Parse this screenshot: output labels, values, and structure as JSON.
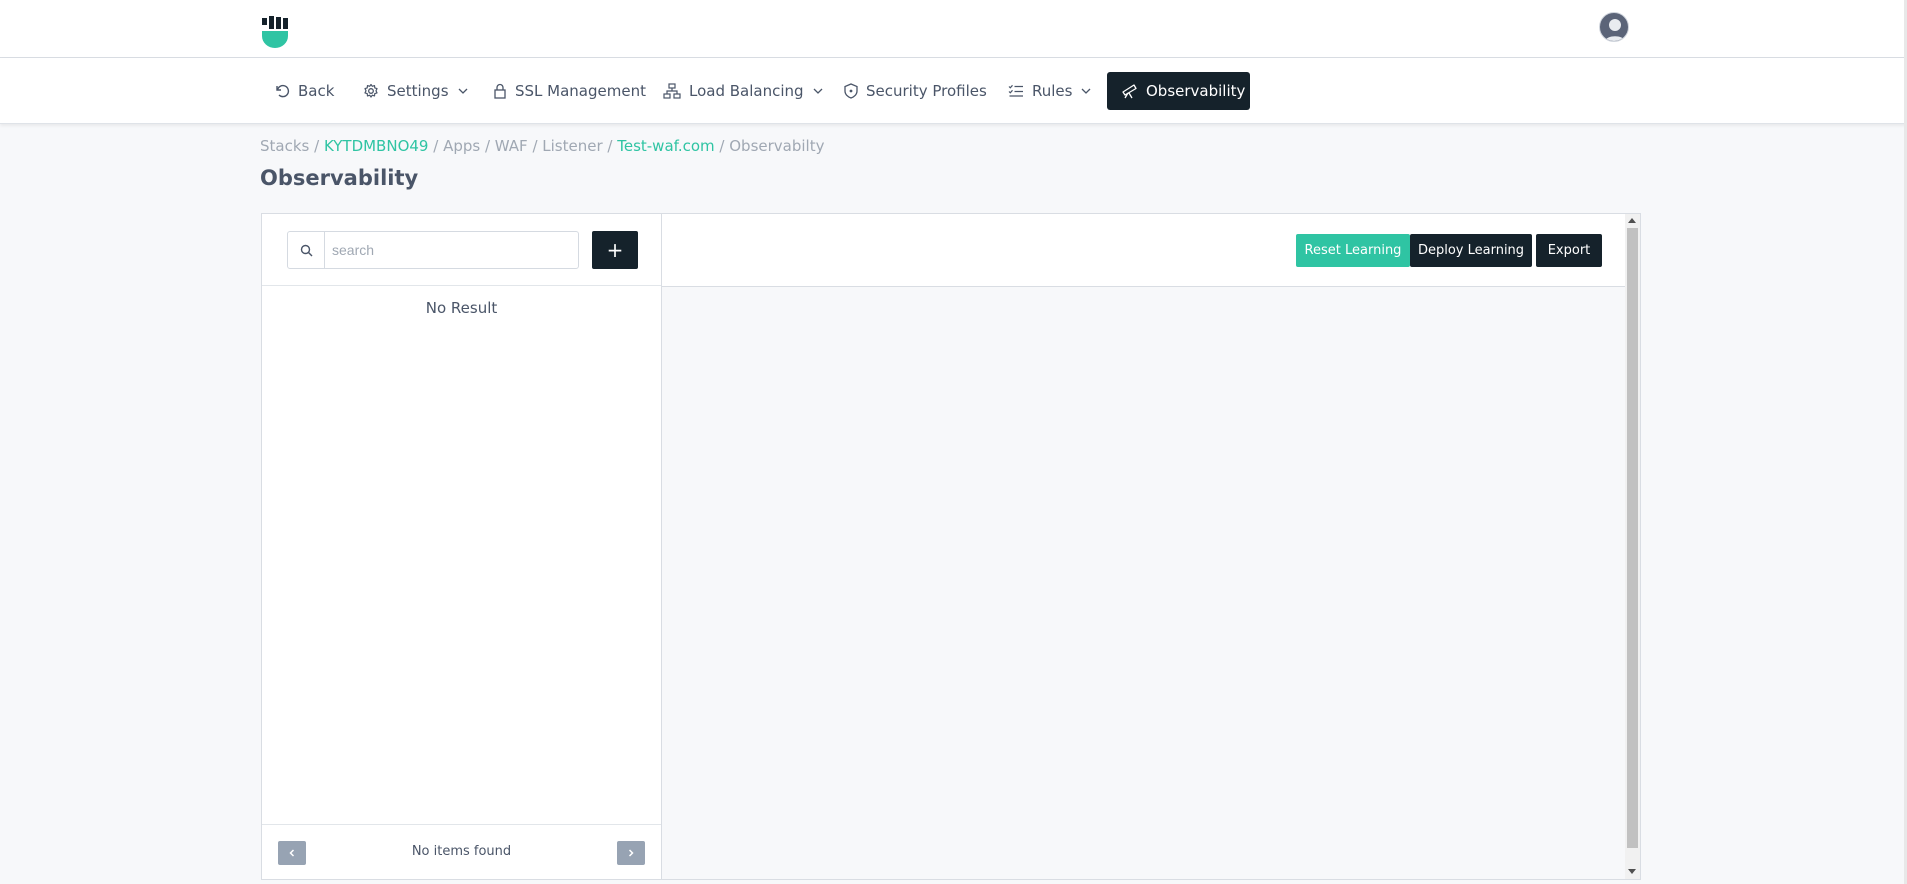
{
  "colors": {
    "accent": "#2fc4a3",
    "dark": "#15222b",
    "muted": "#a0a8b3"
  },
  "nav": {
    "back": {
      "label": "Back",
      "icon": "undo-icon"
    },
    "settings": {
      "label": "Settings",
      "icon": "gear-icon"
    },
    "ssl": {
      "label": "SSL Management",
      "icon": "lock-icon"
    },
    "load_balancing": {
      "label": "Load Balancing",
      "icon": "network-icon"
    },
    "security_profiles": {
      "label": "Security Profiles",
      "icon": "shield-icon"
    },
    "rules": {
      "label": "Rules",
      "icon": "checklist-icon"
    },
    "observability": {
      "label": "Observability",
      "icon": "telescope-icon"
    }
  },
  "breadcrumb": {
    "stacks": "Stacks",
    "stack_id": "KYTDMBNO49",
    "apps": "Apps",
    "waf": "WAF",
    "listener": "Listener",
    "domain": "Test-waf.com",
    "current": "Observabilty",
    "separator": " / "
  },
  "page": {
    "title": "Observability"
  },
  "left": {
    "search_placeholder": "search",
    "add_label": "+",
    "no_result": "No Result",
    "footer_text": "No items found"
  },
  "toolbar": {
    "reset": "Reset Learning",
    "deploy": "Deploy Learning",
    "export": "Export"
  }
}
